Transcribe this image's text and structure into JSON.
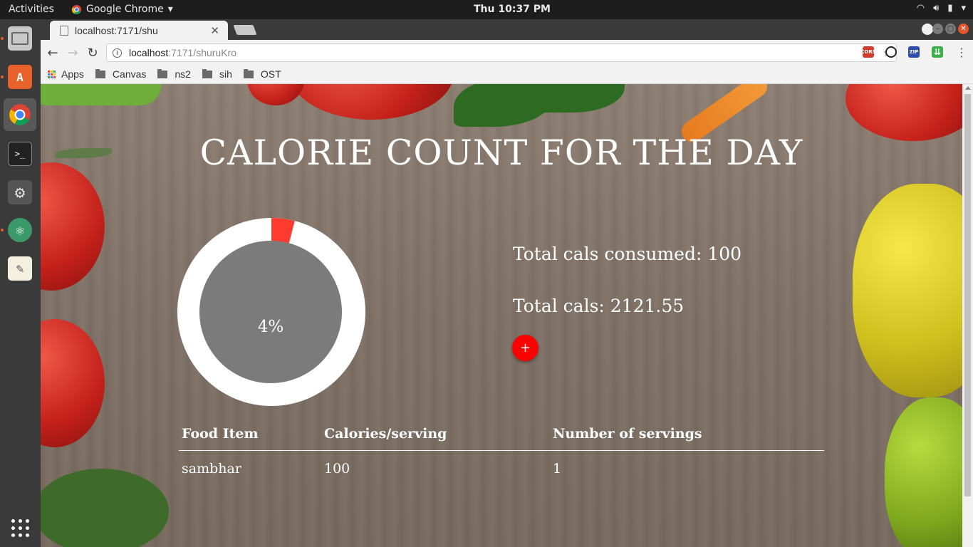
{
  "system": {
    "activities": "Activities",
    "app_name": "Google Chrome",
    "clock": "Thu 10:37 PM"
  },
  "browser": {
    "tab_title": "localhost:7171/shu",
    "url_host": "localhost",
    "url_rest": ":7171/shuruKro",
    "bookmarks": [
      "Apps",
      "Canvas",
      "ns2",
      "sih",
      "OST"
    ],
    "extensions": [
      "CORS",
      "ZIP"
    ]
  },
  "page": {
    "title": "CALORIE COUNT FOR THE DAY",
    "progress_label": "4%",
    "progress_fraction": 0.04,
    "consumed_label": "Total cals consumed: 100",
    "total_label": "Total cals: 2121.55",
    "add_label": "+",
    "colors": {
      "accent": "#ff3b2f",
      "ring": "#ffffff",
      "center": "#7b7b7b",
      "add_button": "#ff0000"
    },
    "table": {
      "headers": [
        "Food Item",
        "Calories/serving",
        "Number of servings"
      ],
      "rows": [
        [
          "sambhar",
          "100",
          "1"
        ]
      ]
    }
  }
}
